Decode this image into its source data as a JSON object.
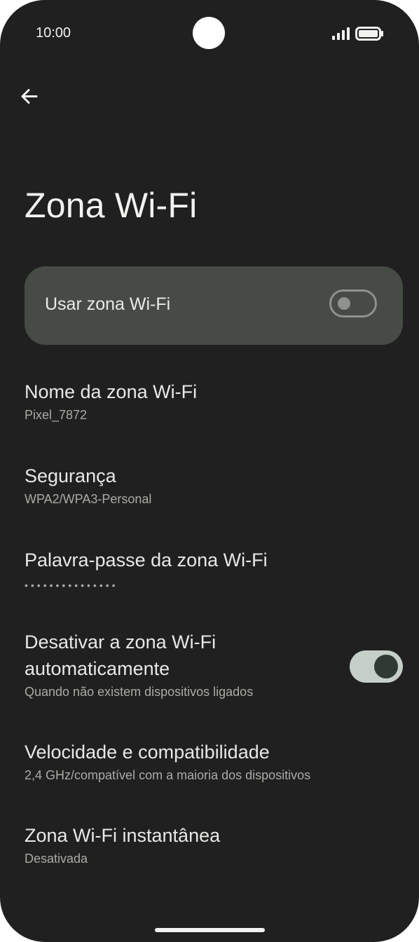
{
  "status_bar": {
    "time": "10:00",
    "signal_icon": "signal-bars-icon",
    "battery_icon": "battery-icon"
  },
  "header": {
    "back_icon": "arrow-back-icon",
    "title": "Zona Wi-Fi"
  },
  "main_toggle": {
    "label": "Usar zona Wi-Fi",
    "enabled": false
  },
  "settings": [
    {
      "title": "Nome da zona Wi-Fi",
      "subtitle": "Pixel_7872"
    },
    {
      "title": "Segurança",
      "subtitle": "WPA2/WPA3-Personal"
    },
    {
      "title": "Palavra-passe da zona Wi-Fi",
      "subtitle": "•••••••••••••••"
    },
    {
      "title": "Desativar a zona Wi-Fi automaticamente",
      "subtitle": "Quando não existem dispositivos ligados",
      "toggle_enabled": true
    },
    {
      "title": "Velocidade e compatibilidade",
      "subtitle": "2,4 GHz/compatível com a maioria dos dispositivos"
    },
    {
      "title": "Zona Wi-Fi instantânea",
      "subtitle": "Desativada"
    }
  ],
  "colors": {
    "background": "#1f201f",
    "card": "#464b46",
    "switch_on_track": "#c6cec8",
    "switch_on_knob": "#2e3a33"
  }
}
